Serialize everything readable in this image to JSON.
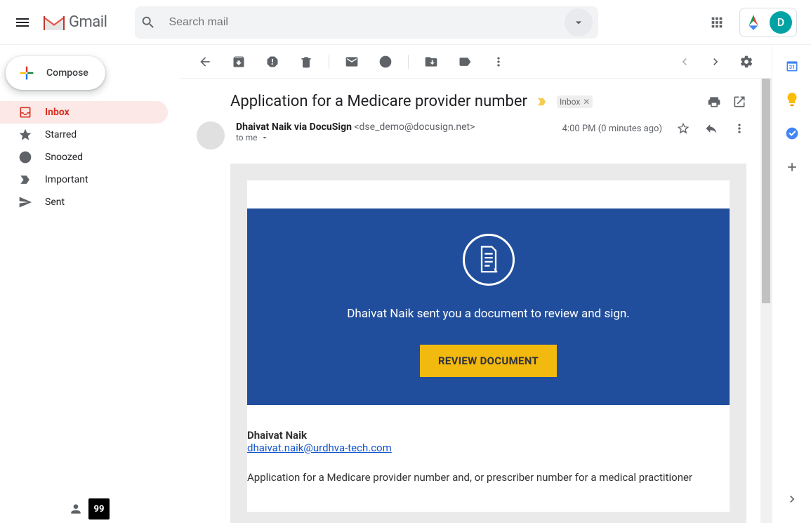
{
  "header": {
    "app_name": "Gmail",
    "search_placeholder": "Search mail",
    "avatar_letter": "D"
  },
  "sidebar": {
    "compose_label": "Compose",
    "items": [
      {
        "label": "Inbox",
        "icon": "inbox",
        "active": true
      },
      {
        "label": "Starred",
        "icon": "star",
        "active": false
      },
      {
        "label": "Snoozed",
        "icon": "clock",
        "active": false
      },
      {
        "label": "Important",
        "icon": "important",
        "active": false
      },
      {
        "label": "Sent",
        "icon": "sent",
        "active": false
      }
    ]
  },
  "message": {
    "subject": "Application for a Medicare provider number",
    "label_chip": "Inbox",
    "sender_name": "Dhaivat Naik via DocuSign",
    "sender_email": "<dse_demo@docusign.net>",
    "to_line": "to me",
    "timestamp": "4:00 PM (0 minutes ago)"
  },
  "email_body": {
    "hero_text": "Dhaivat Naik sent you a document to review and sign.",
    "cta_label": "REVIEW DOCUMENT",
    "from_name": "Dhaivat Naik",
    "from_email": "dhaivat.naik@urdhva-tech.com",
    "paragraph": "Application for a Medicare provider number and, or prescriber number for a medical practitioner"
  },
  "colors": {
    "gmail_red": "#d93025",
    "docusign_blue": "#214e9c",
    "cta_yellow": "#f2b90e"
  }
}
